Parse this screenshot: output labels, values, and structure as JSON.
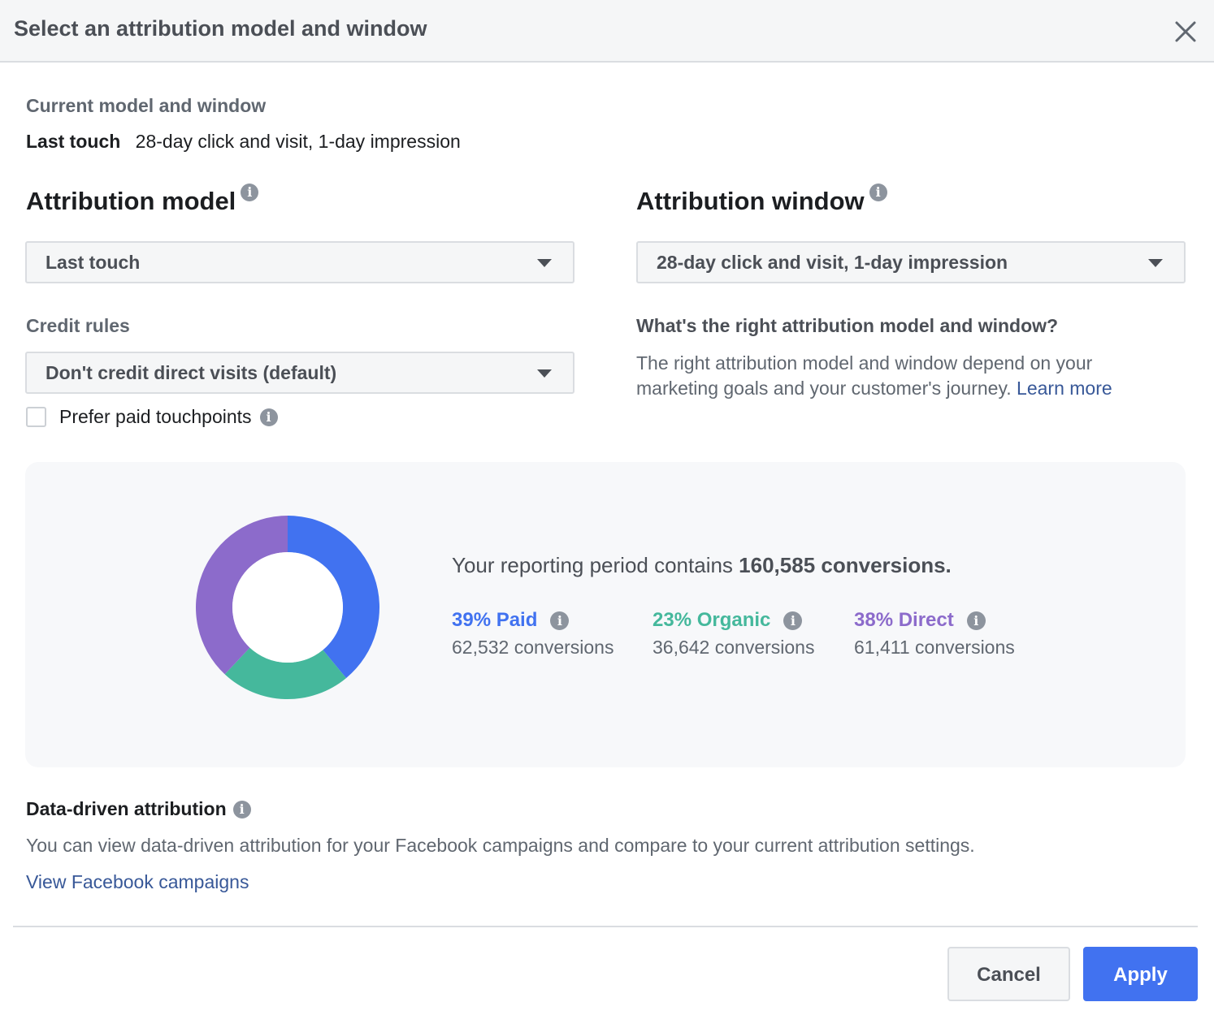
{
  "dialog": {
    "title": "Select an attribution model and window",
    "close_icon": "close-icon"
  },
  "current": {
    "label": "Current model and window",
    "model": "Last touch",
    "window": "28-day click and visit, 1-day impression"
  },
  "attribution_model": {
    "heading": "Attribution model",
    "info_icon": "i",
    "selected": "Last touch"
  },
  "attribution_window": {
    "heading": "Attribution window",
    "info_icon": "i",
    "selected": "28-day click and visit, 1-day impression"
  },
  "credit_rules": {
    "label": "Credit rules",
    "selected": "Don't credit direct visits (default)",
    "prefer_paid": {
      "label": "Prefer paid touchpoints",
      "checked": false,
      "info_icon": "i"
    }
  },
  "help": {
    "title": "What's the right attribution model and window?",
    "text": "The right attribution model and window depend on your marketing goals and your customer's journey.",
    "link": "Learn more"
  },
  "summary": {
    "prefix": "Your reporting period contains",
    "total": "160,585 conversions.",
    "stats": [
      {
        "title": "39% Paid",
        "sub": "62,532 conversions",
        "color": "#4172f0"
      },
      {
        "title": "23% Organic",
        "sub": "36,642 conversions",
        "color": "#45b89c"
      },
      {
        "title": "38% Direct",
        "sub": "61,411 conversions",
        "color": "#8c6bcb"
      }
    ],
    "info_icon": "i"
  },
  "chart_data": {
    "type": "pie",
    "title": "",
    "categories": [
      "Paid",
      "Organic",
      "Direct"
    ],
    "values": [
      39,
      23,
      38
    ],
    "counts": [
      62532,
      36642,
      61411
    ],
    "colors": [
      "#4172f0",
      "#45b89c",
      "#8c6bcb"
    ],
    "donut": true
  },
  "data_driven": {
    "title": "Data-driven attribution",
    "info_icon": "i",
    "text": "You can view data-driven attribution for your Facebook campaigns and compare to your current attribution settings.",
    "link": "View Facebook campaigns"
  },
  "footer": {
    "cancel_label": "Cancel",
    "apply_label": "Apply"
  }
}
